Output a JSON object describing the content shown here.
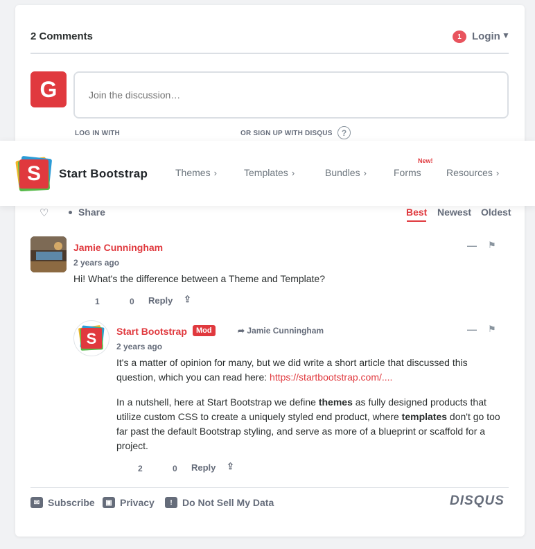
{
  "colors": {
    "accent": "#e0393e",
    "muted": "#656c7a",
    "border": "#dbdfe4"
  },
  "header": {
    "comment_count": "2 Comments",
    "notification_count": "1",
    "login_label": "Login",
    "login_caret": "▼"
  },
  "composer": {
    "avatar_letter": "G",
    "placeholder": "Join the discussion…",
    "login_with": "LOG IN WITH",
    "signup_with": "OR SIGN UP WITH DISQUS",
    "help_glyph": "?"
  },
  "navbar": {
    "logo_letter": "S",
    "brand": "Start Bootstrap",
    "items": [
      {
        "label": "Themes",
        "chevron": "›"
      },
      {
        "label": "Templates",
        "chevron": "›"
      },
      {
        "label": "Bundles",
        "chevron": "›"
      },
      {
        "label": "Forms",
        "chevron": ""
      },
      {
        "label": "Resources",
        "chevron": "›"
      }
    ],
    "new_badge": "New!"
  },
  "toolbar": {
    "heart_icon": "♡",
    "share_label": "Share",
    "sort": [
      "Best",
      "Newest",
      "Oldest"
    ]
  },
  "comments": [
    {
      "author": "Jamie Cunningham",
      "time": "2 years ago",
      "text": "Hi! What's the difference between a Theme and Template?",
      "upvotes": "1",
      "downvotes": "0",
      "reply_label": "Reply"
    },
    {
      "author": "Start Bootstrap",
      "badge": "Mod",
      "reply_to": "Jamie Cunningham",
      "time": "2 years ago",
      "p1_text": "It's a matter of opinion for many, but we did write a short article that discussed this question, which you can read here: ",
      "p1_link": "https://startbootstrap.com/....",
      "p2_a": "In a nutshell, here at Start Bootstrap we define ",
      "p2_b": "themes",
      "p2_c": " as fully designed products that utilize custom CSS to create a uniquely styled end product, where ",
      "p2_d": "templates",
      "p2_e": " don't go too far past the default Bootstrap styling, and serve as more of a blueprint or scaffold for a project.",
      "upvotes": "2",
      "downvotes": "0",
      "reply_label": "Reply"
    }
  ],
  "collapse_glyph": "—",
  "flag_glyph": "⚑",
  "share_glyph": "⇪",
  "footer": {
    "subscribe": "Subscribe",
    "privacy": "Privacy",
    "do_not_sell": "Do Not Sell My Data",
    "brand": "DISQUS"
  }
}
